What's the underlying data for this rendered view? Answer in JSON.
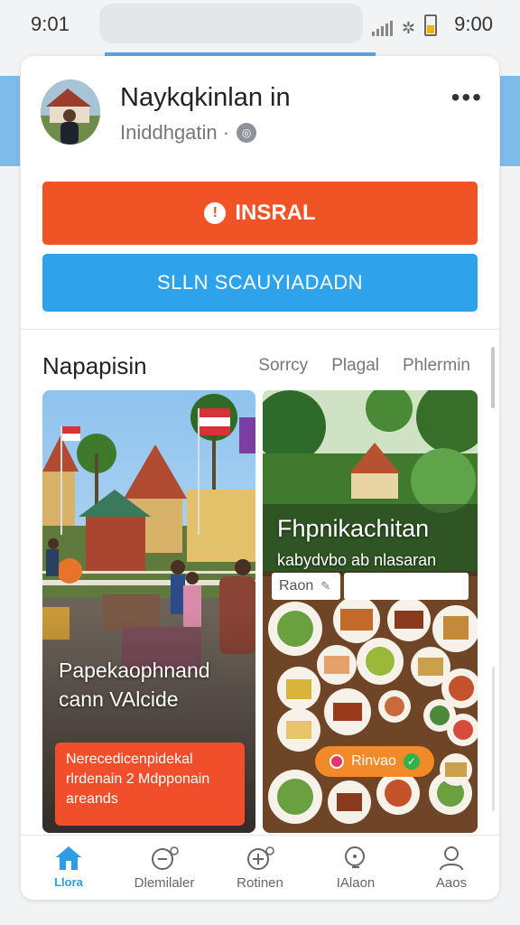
{
  "status_bar": {
    "time_left": "9:01",
    "time_right": "9:00",
    "icons": [
      "signal-icon",
      "wifi-icon",
      "battery-icon"
    ]
  },
  "profile": {
    "name": "Naykqkinlan in",
    "subtitle": "Iniddhgatin ·",
    "more_label": "•••"
  },
  "actions": {
    "primary_label": "INSRAL",
    "primary_color": "#f05325",
    "secondary_label": "SLLN SCAUYIADADN",
    "secondary_color": "#2ea2eb"
  },
  "section": {
    "title": "Napapisin",
    "tabs": [
      "Sorrcy",
      "Plagal",
      "Phlermin"
    ]
  },
  "tiles": {
    "left": {
      "caption_line1": "Papekaophnand",
      "caption_line2": "cann VAlcide",
      "notice_line1": "Nerecedicenpidekal",
      "notice_line2": "rlrdenain 2 Mdpponain",
      "notice_line3": "areands"
    },
    "right": {
      "title": "Fhpnikachitan",
      "subtitle": "kabydvbo ab nlasaran",
      "input_value": "Raon",
      "chip_label": "Rinvao"
    }
  },
  "bottom_nav": {
    "items": [
      {
        "label": "Llora",
        "icon": "home-icon",
        "active": true
      },
      {
        "label": "Dlemilaler",
        "icon": "chat-icon",
        "active": false
      },
      {
        "label": "Rotinen",
        "icon": "add-icon",
        "active": false
      },
      {
        "label": "IAlaon",
        "icon": "search-icon",
        "active": false
      },
      {
        "label": "Aaos",
        "icon": "person-icon",
        "active": false
      }
    ],
    "active_color": "#2e9be6"
  }
}
